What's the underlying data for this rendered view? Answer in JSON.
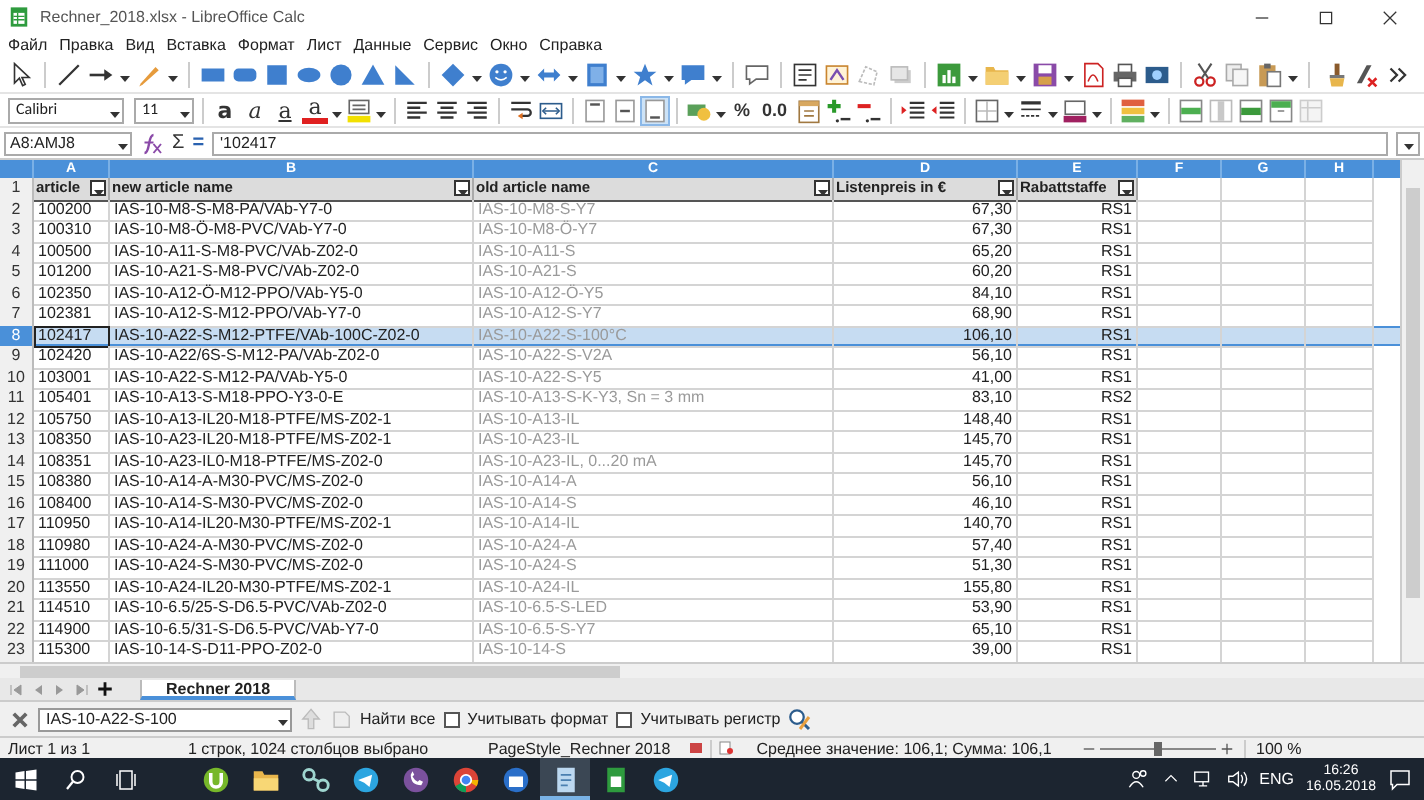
{
  "window": {
    "title": "Rechner_2018.xlsx - LibreOffice Calc"
  },
  "menu": [
    "Файл",
    "Правка",
    "Вид",
    "Вставка",
    "Формат",
    "Лист",
    "Данные",
    "Сервис",
    "Окно",
    "Справка"
  ],
  "format_toolbar": {
    "font": "Calibri",
    "size": "11",
    "style_buttons": [
      {
        "kind": "bold",
        "glyph": "a"
      },
      {
        "kind": "italic",
        "glyph": "a"
      },
      {
        "kind": "underline",
        "glyph": "a"
      },
      {
        "kind": "font-color",
        "glyph": "a"
      }
    ],
    "vertical_align": [
      {
        "selected": false
      },
      {
        "selected": false
      },
      {
        "selected": true
      }
    ],
    "percent_label": "%",
    "decimal_label": "0.0"
  },
  "formula_bar": {
    "name_box": "A8:AMJ8",
    "sum_glyph": "Σ",
    "equals_glyph": "=",
    "content": "'102417"
  },
  "sheet": {
    "columns": [
      "A",
      "B",
      "C",
      "D",
      "E",
      "F",
      "G",
      "H"
    ],
    "header_row": {
      "number": "1",
      "cells": [
        {
          "text": "article",
          "filter": true
        },
        {
          "text": "new article name",
          "filter": true
        },
        {
          "text": "old article name",
          "filter": true
        },
        {
          "text": "Listenpreis in €",
          "filter": true
        },
        {
          "text": "Rabattstaffe",
          "filter": true
        }
      ]
    },
    "rows": [
      {
        "number": "2",
        "selected": false,
        "cells": [
          "100200",
          "IAS-10-M8-S-M8-PA/VAb-Y7-0",
          "IAS-10-M8-S-Y7",
          "67,30",
          "RS1"
        ]
      },
      {
        "number": "3",
        "selected": false,
        "cells": [
          "100310",
          "IAS-10-M8-Ö-M8-PVC/VAb-Y7-0",
          "IAS-10-M8-Ö-Y7",
          "67,30",
          "RS1"
        ]
      },
      {
        "number": "4",
        "selected": false,
        "cells": [
          "100500",
          "IAS-10-A11-S-M8-PVC/VAb-Z02-0",
          "IAS-10-A11-S",
          "65,20",
          "RS1"
        ]
      },
      {
        "number": "5",
        "selected": false,
        "cells": [
          "101200",
          "IAS-10-A21-S-M8-PVC/VAb-Z02-0",
          "IAS-10-A21-S",
          "60,20",
          "RS1"
        ]
      },
      {
        "number": "6",
        "selected": false,
        "cells": [
          "102350",
          "IAS-10-A12-Ö-M12-PPO/VAb-Y5-0",
          "IAS-10-A12-Ö-Y5",
          "84,10",
          "RS1"
        ]
      },
      {
        "number": "7",
        "selected": false,
        "cells": [
          "102381",
          "IAS-10-A12-S-M12-PPO/VAb-Y7-0",
          "IAS-10-A12-S-Y7",
          "68,90",
          "RS1"
        ]
      },
      {
        "number": "8",
        "selected": true,
        "cells": [
          "102417",
          "IAS-10-A22-S-M12-PTFE/VAb-100C-Z02-0",
          "IAS-10-A22-S-100°C",
          "106,10",
          "RS1"
        ]
      },
      {
        "number": "9",
        "selected": false,
        "cells": [
          "102420",
          "IAS-10-A22/6S-S-M12-PA/VAb-Z02-0",
          "IAS-10-A22-S-V2A",
          "56,10",
          "RS1"
        ]
      },
      {
        "number": "10",
        "selected": false,
        "cells": [
          "103001",
          "IAS-10-A22-S-M12-PA/VAb-Y5-0",
          "IAS-10-A22-S-Y5",
          "41,00",
          "RS1"
        ]
      },
      {
        "number": "11",
        "selected": false,
        "cells": [
          "105401",
          "IAS-10-A13-S-M18-PPO-Y3-0-E",
          "IAS-10-A13-S-K-Y3, Sn = 3 mm",
          "83,10",
          "RS2"
        ]
      },
      {
        "number": "12",
        "selected": false,
        "cells": [
          "105750",
          "IAS-10-A13-IL20-M18-PTFE/MS-Z02-1",
          "IAS-10-A13-IL",
          "148,40",
          "RS1"
        ]
      },
      {
        "number": "13",
        "selected": false,
        "cells": [
          "108350",
          "IAS-10-A23-IL20-M18-PTFE/MS-Z02-1",
          "IAS-10-A23-IL",
          "145,70",
          "RS1"
        ]
      },
      {
        "number": "14",
        "selected": false,
        "cells": [
          "108351",
          "IAS-10-A23-IL0-M18-PTFE/MS-Z02-0",
          "IAS-10-A23-IL, 0...20 mA",
          "145,70",
          "RS1"
        ]
      },
      {
        "number": "15",
        "selected": false,
        "cells": [
          "108380",
          "IAS-10-A14-A-M30-PVC/MS-Z02-0",
          "IAS-10-A14-A",
          "56,10",
          "RS1"
        ]
      },
      {
        "number": "16",
        "selected": false,
        "cells": [
          "108400",
          "IAS-10-A14-S-M30-PVC/MS-Z02-0",
          "IAS-10-A14-S",
          "46,10",
          "RS1"
        ]
      },
      {
        "number": "17",
        "selected": false,
        "cells": [
          "110950",
          "IAS-10-A14-IL20-M30-PTFE/MS-Z02-1",
          "IAS-10-A14-IL",
          "140,70",
          "RS1"
        ]
      },
      {
        "number": "18",
        "selected": false,
        "cells": [
          "110980",
          "IAS-10-A24-A-M30-PVC/MS-Z02-0",
          "IAS-10-A24-A",
          "57,40",
          "RS1"
        ]
      },
      {
        "number": "19",
        "selected": false,
        "cells": [
          "111000",
          "IAS-10-A24-S-M30-PVC/MS-Z02-0",
          "IAS-10-A24-S",
          "51,30",
          "RS1"
        ]
      },
      {
        "number": "20",
        "selected": false,
        "cells": [
          "113550",
          "IAS-10-A24-IL20-M30-PTFE/MS-Z02-1",
          "IAS-10-A24-IL",
          "155,80",
          "RS1"
        ]
      },
      {
        "number": "21",
        "selected": false,
        "cells": [
          "114510",
          "IAS-10-6.5/25-S-D6.5-PVC/VAb-Z02-0",
          "IAS-10-6.5-S-LED",
          "53,90",
          "RS1"
        ]
      },
      {
        "number": "22",
        "selected": false,
        "cells": [
          "114900",
          "IAS-10-6.5/31-S-D6.5-PVC/VAb-Y7-0",
          "IAS-10-6.5-S-Y7",
          "65,10",
          "RS1"
        ]
      },
      {
        "number": "23",
        "selected": false,
        "cells": [
          "115300",
          "IAS-10-14-S-D11-PPO-Z02-0",
          "IAS-10-14-S",
          "39,00",
          "RS1"
        ]
      }
    ]
  },
  "sheet_tabs": [
    {
      "label": "Rechner 2018",
      "selected": true
    }
  ],
  "find_bar": {
    "value": "IAS-10-A22-S-100",
    "find_all": "Найти все",
    "options": [
      {
        "label": "Учитывать формат",
        "checked": false
      },
      {
        "label": "Учитывать регистр",
        "checked": false
      }
    ]
  },
  "status_bar": {
    "sheet": "Лист 1 из 1",
    "selection": "1 строк, 1024 столбцов выбрано",
    "page_style": "PageStyle_Rechner 2018",
    "summary": "Среднее значение: 106,1; Сумма: 106,1",
    "zoom": {
      "level": 0.5,
      "reading": "100 %"
    }
  },
  "taskbar": {
    "apps": [
      {
        "kind": "torrent",
        "active": false
      },
      {
        "kind": "folder",
        "active": false
      },
      {
        "kind": "network",
        "active": false
      },
      {
        "kind": "telegram",
        "active": false
      },
      {
        "kind": "viber",
        "active": false
      },
      {
        "kind": "chrome",
        "active": false
      },
      {
        "kind": "mail",
        "active": false
      },
      {
        "kind": "document",
        "active": true
      },
      {
        "kind": "spreadsheet",
        "active": false
      },
      {
        "kind": "telegram",
        "active": false
      }
    ],
    "language": "ENG",
    "time": "16:26",
    "date": "16.05.2018"
  }
}
